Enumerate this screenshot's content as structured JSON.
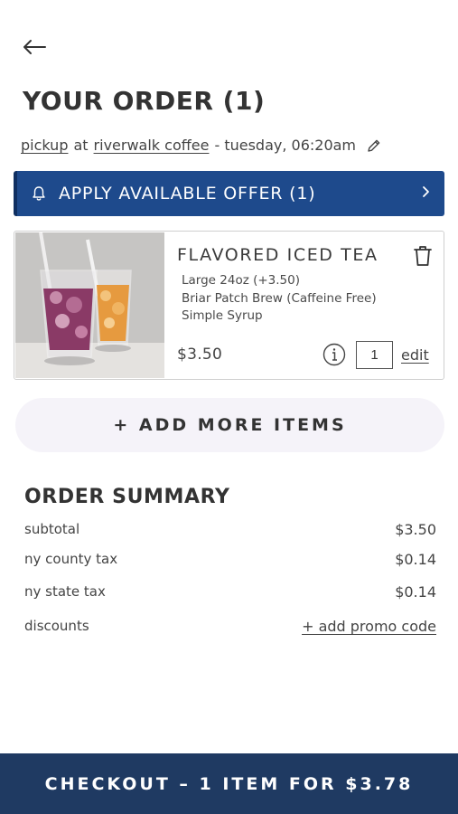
{
  "header": {
    "back_icon": "arrow-left-icon",
    "title": "YOUR ORDER (1)"
  },
  "pickup": {
    "method": "pickup",
    "at": "at",
    "location": "riverwalk coffee",
    "time": "- tuesday, 06:20am",
    "edit_icon": "pencil-icon"
  },
  "offer": {
    "icon": "bell-icon",
    "label": "APPLY AVAILABLE OFFER (1)",
    "chevron_icon": "chevron-right-icon",
    "color": "#1e4a8c"
  },
  "cart": {
    "items": [
      {
        "name": "FLAVORED ICED TEA",
        "modifiers": [
          "Large 24oz (+3.50)",
          "Briar Patch Brew (Caffeine Free)",
          "Simple Syrup"
        ],
        "price": "$3.50",
        "quantity": "1",
        "edit_label": "edit",
        "delete_icon": "trash-icon",
        "info_icon": "info-icon"
      }
    ]
  },
  "add_more_label": "+ ADD MORE ITEMS",
  "summary": {
    "title": "ORDER SUMMARY",
    "subtotal_label": "subtotal",
    "subtotal_value": "$3.50",
    "county_tax_label": "ny county tax",
    "county_tax_value": "$0.14",
    "state_tax_label": "ny state tax",
    "state_tax_value": "$0.14",
    "discounts_label": "discounts",
    "promo_label": "+ add promo code"
  },
  "checkout": {
    "label": "CHECKOUT – 1 ITEM FOR $3.78",
    "color": "#1f3a62"
  }
}
